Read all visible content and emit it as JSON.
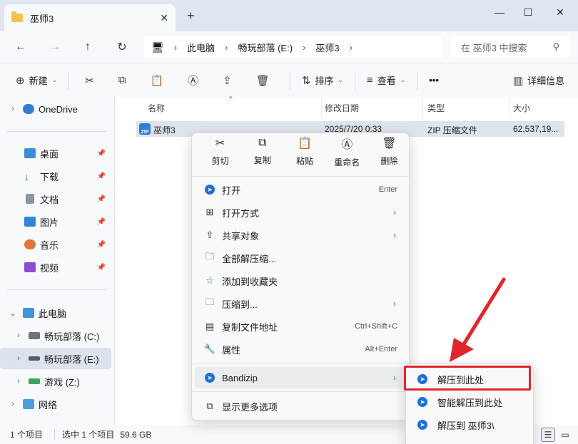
{
  "window": {
    "tab_title": "巫师3",
    "new_tab_symbol": "+",
    "close_symbol": "✕"
  },
  "nav": {
    "back": "←",
    "forward": "→",
    "up": "↑",
    "refresh": "↻"
  },
  "address": {
    "segments": [
      "此电脑",
      "畅玩部落 (E:)",
      "巫师3"
    ]
  },
  "search": {
    "placeholder": "在 巫师3 中搜索"
  },
  "toolbar": {
    "new_label": "新建",
    "sort_label": "排序",
    "view_label": "查看",
    "more_label": "•••",
    "details_label": "详细信息"
  },
  "sidebar": {
    "items": [
      {
        "label": "OneDrive"
      },
      {
        "label": "桌面"
      },
      {
        "label": "下载"
      },
      {
        "label": "文档"
      },
      {
        "label": "图片"
      },
      {
        "label": "音乐"
      },
      {
        "label": "视频"
      },
      {
        "label": "此电脑"
      },
      {
        "label": "畅玩部落 (C:)"
      },
      {
        "label": "畅玩部落 (E:)"
      },
      {
        "label": "游戏 (Z:)"
      },
      {
        "label": "网络"
      }
    ]
  },
  "columns": {
    "name": "名称",
    "date": "修改日期",
    "type": "类型",
    "size": "大小"
  },
  "file": {
    "name": "巫师3",
    "date": "2025/7/20 0:33",
    "type": "ZIP 压缩文件",
    "size": "62,537,19..."
  },
  "context_menu": {
    "quick": [
      "剪切",
      "复制",
      "粘贴",
      "重命名",
      "删除"
    ],
    "items": [
      {
        "label": "打开",
        "shortcut": "Enter"
      },
      {
        "label": "打开方式",
        "shortcut": ""
      },
      {
        "label": "共享对象",
        "shortcut": ""
      },
      {
        "label": "全部解压缩...",
        "shortcut": ""
      },
      {
        "label": "添加到收藏夹",
        "shortcut": ""
      },
      {
        "label": "压缩到...",
        "shortcut": ""
      },
      {
        "label": "复制文件地址",
        "shortcut": "Ctrl+Shift+C"
      },
      {
        "label": "属性",
        "shortcut": "Alt+Enter"
      },
      {
        "label": "Bandizip",
        "shortcut": ""
      },
      {
        "label": "显示更多选项",
        "shortcut": ""
      }
    ]
  },
  "submenu": {
    "items": [
      "解压到此处",
      "智能解压到此处",
      "解压到 巫师3\\"
    ]
  },
  "status": {
    "count": "1 个项目",
    "selected": "选中 1 个项目",
    "size": "59.6 GB"
  },
  "colors": {
    "accent": "#1e6fd9",
    "highlight_red": "#e0262c"
  }
}
